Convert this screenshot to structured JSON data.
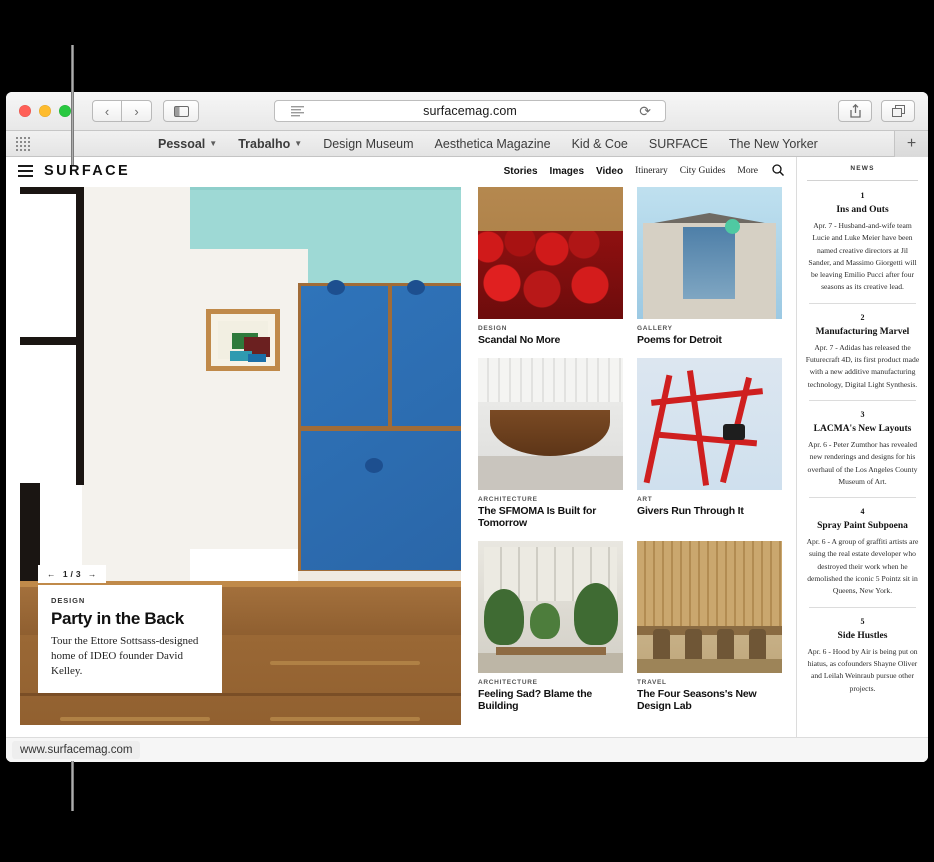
{
  "browser": {
    "address": "surfacemag.com",
    "icons": {
      "back": "back-arrow-icon",
      "forward": "forward-arrow-icon",
      "sidebar": "sidebar-toggle-icon",
      "reader": "reader-view-icon",
      "reload": "reload-icon",
      "share": "share-icon",
      "tabs": "show-all-tabs-icon",
      "new_tab": "new-tab-plus-icon",
      "apps_grid": "apps-grid-icon"
    },
    "bookmarks": [
      {
        "label": "Pessoal",
        "has_chevron": true,
        "bold": true
      },
      {
        "label": "Trabalho",
        "has_chevron": true,
        "bold": true
      },
      {
        "label": "Design Museum",
        "has_chevron": false,
        "bold": false
      },
      {
        "label": "Aesthetica Magazine",
        "has_chevron": false,
        "bold": false
      },
      {
        "label": "Kid & Coe",
        "has_chevron": false,
        "bold": false
      },
      {
        "label": "SURFACE",
        "has_chevron": false,
        "bold": false
      },
      {
        "label": "The New Yorker",
        "has_chevron": false,
        "bold": false
      }
    ],
    "status_url": "www.surfacemag.com"
  },
  "site": {
    "brand": "SURFACE",
    "nav_primary": [
      "Stories",
      "Images",
      "Video"
    ],
    "nav_secondary": [
      "Itinerary",
      "City Guides",
      "More"
    ],
    "search_icon": "search-icon"
  },
  "hero": {
    "pager": {
      "prev": "←",
      "index": "1 / 3",
      "next": "→"
    },
    "kicker": "DESIGN",
    "title": "Party in the Back",
    "body": "Tour the Ettore Sottsass-designed home of IDEO founder David Kelley."
  },
  "cards": [
    {
      "kicker": "DESIGN",
      "title": "Scandal No More",
      "art": "theater"
    },
    {
      "kicker": "GALLERY",
      "title": "Poems for Detroit",
      "art": "gallery"
    },
    {
      "kicker": "ARCHITECTURE",
      "title": "The SFMOMA Is Built for Tomorrow",
      "art": "sfmoma"
    },
    {
      "kicker": "ART",
      "title": "Givers Run Through It",
      "art": "art"
    },
    {
      "kicker": "ARCHITECTURE",
      "title": "Feeling Sad? Blame the Building",
      "art": "plants"
    },
    {
      "kicker": "TRAVEL",
      "title": "The Four Seasons's New Design Lab",
      "art": "travel"
    }
  ],
  "news": {
    "label": "NEWS",
    "items": [
      {
        "num": "1",
        "title": "Ins and Outs",
        "body": "Apr. 7 - Husband-and-wife team Lucie and Luke Meier have been named creative directors at Jil Sander, and Massimo Giorgetti will be leaving Emilio Pucci after four seasons as its creative lead."
      },
      {
        "num": "2",
        "title": "Manufacturing Marvel",
        "body": "Apr. 7 - Adidas has released the Futurecraft 4D, its first product made with a new additive manufacturing technology, Digital Light Synthesis."
      },
      {
        "num": "3",
        "title": "LACMA's New Layouts",
        "body": "Apr. 6 - Peter Zumthor has revealed new renderings and designs for his overhaul of the Los Angeles County Museum of Art."
      },
      {
        "num": "4",
        "title": "Spray Paint Subpoena",
        "body": "Apr. 6 - A group of graffiti artists are suing the real estate developer who destroyed their work when he demolished the iconic 5 Pointz sit in Queens, New York."
      },
      {
        "num": "5",
        "title": "Side Hustles",
        "body": "Apr. 6 - Hood by Air is being put on hiatus, as cofounders Shayne Oliver and Leilah Weinraub pursue other projects."
      }
    ]
  },
  "colors": {
    "hero_wall": "#9ed9d5",
    "hero_cabinet": "#2f74ba",
    "traffic_red": "#ff5f57",
    "traffic_yellow": "#febc2e",
    "traffic_green": "#28c840"
  }
}
